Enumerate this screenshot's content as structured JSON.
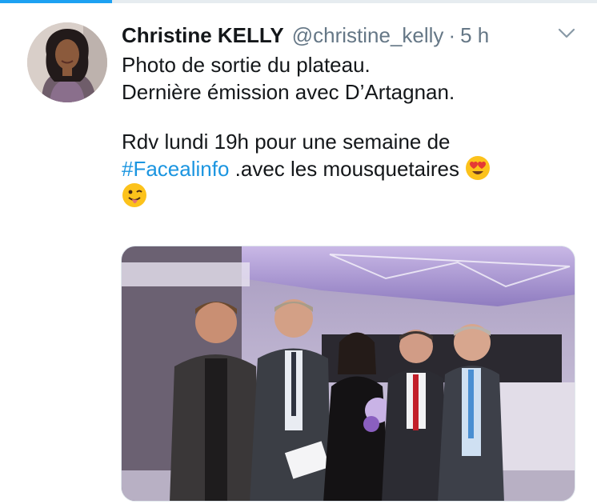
{
  "tweet": {
    "author_name": "Christine KELLY",
    "handle": "@christine_kelly",
    "separator": "·",
    "time": "5 h",
    "lines": [
      "Photo de sortie du plateau.",
      "Dernière émission avec D’Artagnan."
    ],
    "line3": "Rdv lundi 19h pour une semaine  de",
    "hashtag": "#Facealinfo",
    "after_hashtag": " .avec les mousquetaires",
    "emoji_1": "heart-eyes-emoji",
    "emoji_2": "winking-tongue-emoji"
  },
  "icons": {
    "caret": "chevron-down-icon",
    "avatar": "profile-avatar"
  },
  "colors": {
    "accent": "#1da1f2",
    "hashtag": "#1b95e0",
    "muted": "#657786",
    "text": "#14171a"
  }
}
